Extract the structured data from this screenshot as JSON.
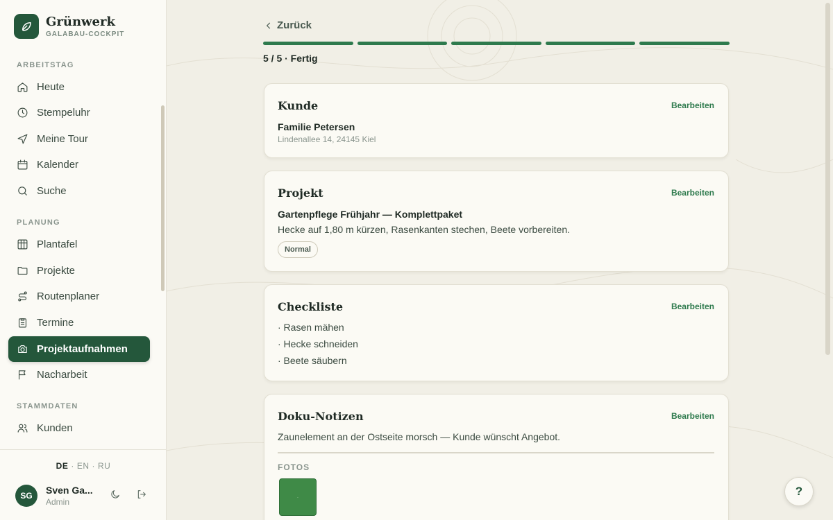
{
  "brand": {
    "name": "Grünwerk",
    "subtitle": "GALABAU-COCKPIT"
  },
  "sidebar": {
    "sections": [
      {
        "title": "ARBEITSTAG"
      },
      {
        "title": "PLANUNG"
      },
      {
        "title": "STAMMDATEN"
      }
    ],
    "items": [
      {
        "label": "Heute",
        "icon": "home-icon"
      },
      {
        "label": "Stempeluhr",
        "icon": "clock-icon"
      },
      {
        "label": "Meine Tour",
        "icon": "navigation-icon"
      },
      {
        "label": "Kalender",
        "icon": "calendar-icon"
      },
      {
        "label": "Suche",
        "icon": "search-icon"
      },
      {
        "label": "Plantafel",
        "icon": "grid-icon"
      },
      {
        "label": "Projekte",
        "icon": "folder-icon"
      },
      {
        "label": "Routenplaner",
        "icon": "route-icon"
      },
      {
        "label": "Termine",
        "icon": "clipboard-icon"
      },
      {
        "label": "Projektaufnahmen",
        "icon": "camera-icon",
        "active": true
      },
      {
        "label": "Nacharbeit",
        "icon": "flag-icon"
      },
      {
        "label": "Kunden",
        "icon": "users-icon"
      }
    ],
    "languages": [
      "DE",
      "EN",
      "RU"
    ],
    "active_language": "DE",
    "user": {
      "initials": "SG",
      "name": "Sven Ga...",
      "role": "Admin"
    }
  },
  "main": {
    "back_label": "Zurück",
    "progress": {
      "current": 5,
      "total": 5,
      "text": "5 / 5 · Fertig"
    },
    "edit_label": "Bearbeiten",
    "customer": {
      "title": "Kunde",
      "name": "Familie Petersen",
      "address": "Lindenallee 14, 24145 Kiel"
    },
    "project": {
      "title": "Projekt",
      "name": "Gartenpflege Frühjahr — Komplettpaket",
      "description": "Hecke auf 1,80 m kürzen, Rasenkanten stechen, Beete vorbereiten.",
      "priority": "Normal"
    },
    "checklist": {
      "title": "Checkliste",
      "items": [
        "· Rasen mähen",
        "· Hecke schneiden",
        "· Beete säubern"
      ]
    },
    "notes": {
      "title": "Doku-Notizen",
      "text": "Zaunelement an der Ostseite morsch — Kunde wünscht Angebot.",
      "photos_label": "FOTOS"
    },
    "help_label": "?"
  },
  "colors": {
    "accent": "#24573b",
    "progress": "#2e7a4d",
    "background": "#f1efe6",
    "card": "#fbfaf4"
  }
}
